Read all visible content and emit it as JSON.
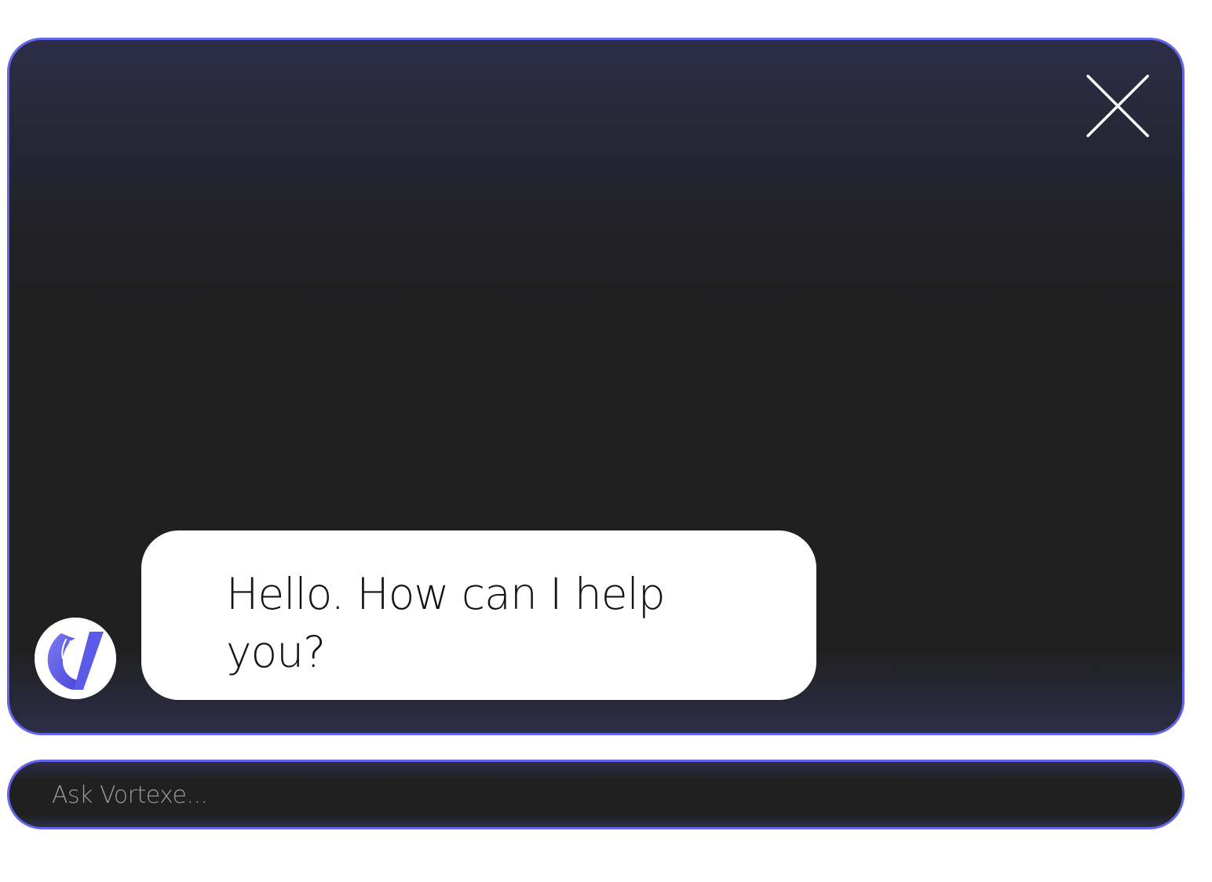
{
  "chat": {
    "messages": [
      {
        "sender": "assistant",
        "text": "Hello. How can I help you?"
      }
    ]
  },
  "input": {
    "placeholder": "Ask Vortexe...",
    "value": ""
  },
  "icons": {
    "close": "close-icon",
    "avatar_logo": "vortexe-logo"
  },
  "colors": {
    "accent_border": "#6366e8",
    "window_bg": "#202020",
    "window_glow": "#2c2d48",
    "bubble_bg": "#ffffff",
    "logo_primary": "#5b5bea"
  }
}
